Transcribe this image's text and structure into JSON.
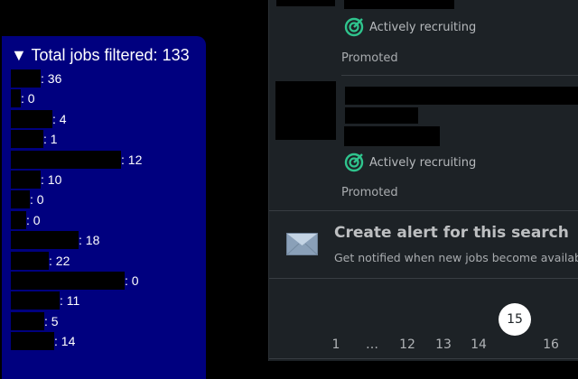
{
  "filter_panel": {
    "title": "▼ Total jobs filtered: 133",
    "rows": [
      {
        "count": ": 36"
      },
      {
        "count": ": 0"
      },
      {
        "count": ": 4"
      },
      {
        "count": ": 1"
      },
      {
        "count": ": 12"
      },
      {
        "count": ": 10"
      },
      {
        "count": ": 0"
      },
      {
        "count": ": 0"
      },
      {
        "count": ": 18"
      },
      {
        "count": ": 22"
      },
      {
        "count": ": 0"
      },
      {
        "count": ": 11"
      },
      {
        "count": ": 5"
      },
      {
        "count": ": 14"
      }
    ]
  },
  "jobs": [
    {
      "status": "Actively recruiting",
      "tag": "Promoted"
    },
    {
      "status": "Actively recruiting",
      "tag": "Promoted"
    }
  ],
  "alert": {
    "title": "Create alert for this search",
    "subtitle": "Get notified when new jobs become available"
  },
  "pagination": {
    "pages": [
      "1",
      "…",
      "12",
      "13",
      "14",
      "15",
      "16"
    ],
    "current": "15"
  },
  "colors": {
    "panel": "#00007f",
    "accent": "#2fc48d",
    "bg": "#1d2226"
  }
}
